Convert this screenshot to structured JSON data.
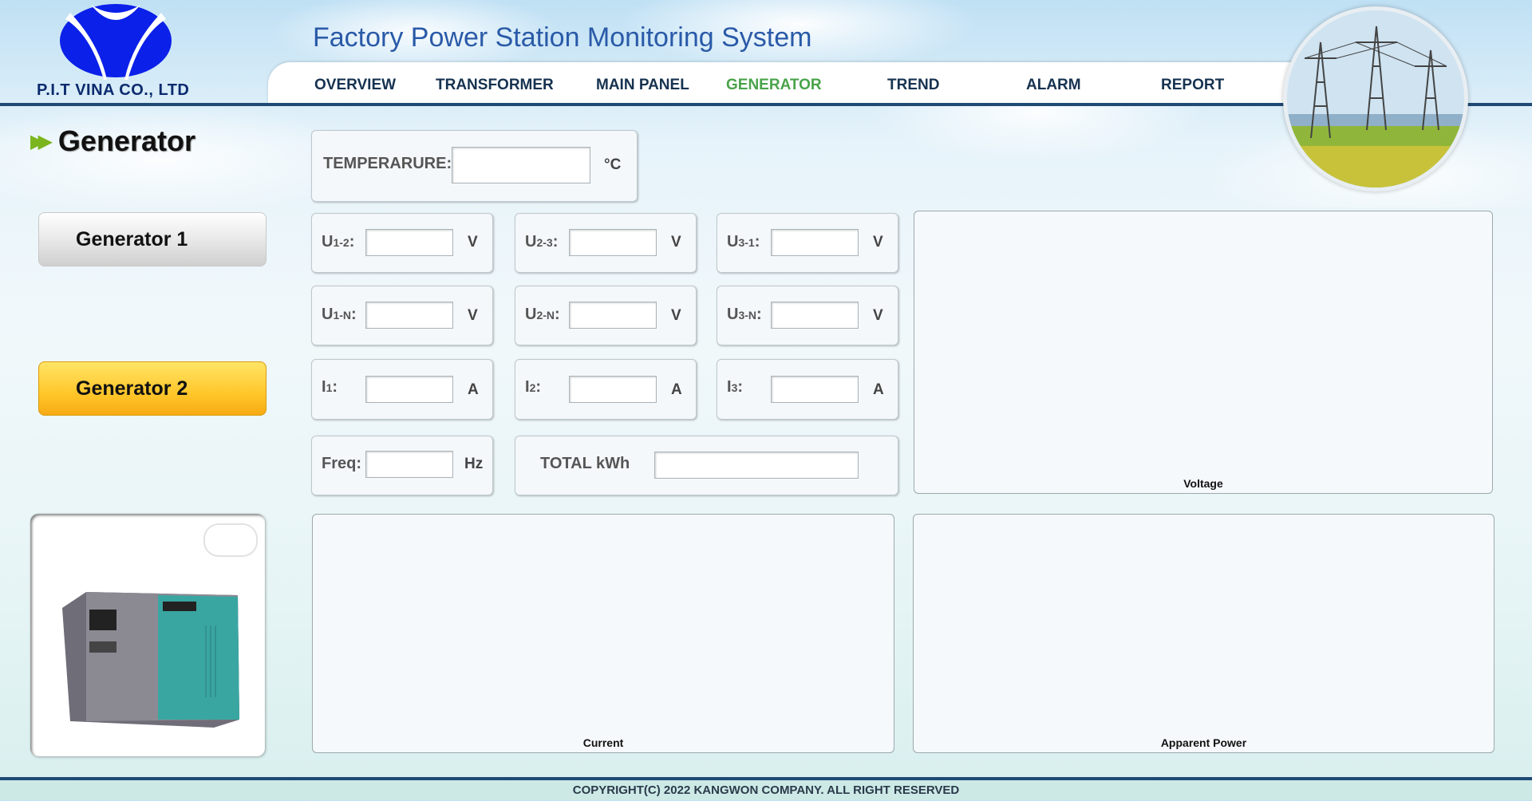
{
  "header": {
    "company": "P.I.T VINA CO., LTD",
    "title": "Factory Power Station Monitoring System",
    "nav": [
      {
        "label": "OVERVIEW"
      },
      {
        "label": "TRANSFORMER"
      },
      {
        "label": "MAIN PANEL"
      },
      {
        "label": "GENERATOR",
        "active": true
      },
      {
        "label": "TREND"
      },
      {
        "label": "ALARM"
      },
      {
        "label": "REPORT"
      }
    ]
  },
  "section": {
    "title": "Generator"
  },
  "generators": [
    {
      "label": "Generator 1"
    },
    {
      "label": "Generator 2",
      "selected": true
    }
  ],
  "temperature": {
    "label": "TEMPERARURE:",
    "value": "",
    "unit": "°C"
  },
  "readings": {
    "u12": {
      "main": "U",
      "sub": "1-2",
      "colon": ":",
      "value": "",
      "unit": "V"
    },
    "u23": {
      "main": "U",
      "sub": "2-3",
      "colon": ":",
      "value": "",
      "unit": "V"
    },
    "u31": {
      "main": "U",
      "sub": "3-1",
      "colon": ":",
      "value": "",
      "unit": "V"
    },
    "u1n": {
      "main": "U",
      "sub": "1-N",
      "colon": ":",
      "value": "",
      "unit": "V"
    },
    "u2n": {
      "main": "U",
      "sub": "2-N",
      "colon": ":",
      "value": "",
      "unit": "V"
    },
    "u3n": {
      "main": "U",
      "sub": "3-N",
      "colon": ":",
      "value": "",
      "unit": "V"
    },
    "i1": {
      "main": "I",
      "sub": "1",
      "colon": ":",
      "value": "",
      "unit": "A"
    },
    "i2": {
      "main": "I",
      "sub": "2",
      "colon": ":",
      "value": "",
      "unit": "A"
    },
    "i3": {
      "main": "I",
      "sub": "3",
      "colon": ":",
      "value": "",
      "unit": "A"
    },
    "freq": {
      "label": "Freq:",
      "value": "",
      "unit": "Hz"
    },
    "total": {
      "label": "TOTAL kWh",
      "value": ""
    }
  },
  "charts": {
    "voltage": "Voltage",
    "current": "Current",
    "apparent": "Apparent Power"
  },
  "footer": "COPYRIGHT(C) 2022 KANGWON COMPANY. ALL RIGHT RESERVED",
  "colors": {
    "accent": "#4aa34a",
    "header_line": "#1f4a74",
    "generator_selected": "#ffc62a",
    "logo": "#0b20e8"
  }
}
